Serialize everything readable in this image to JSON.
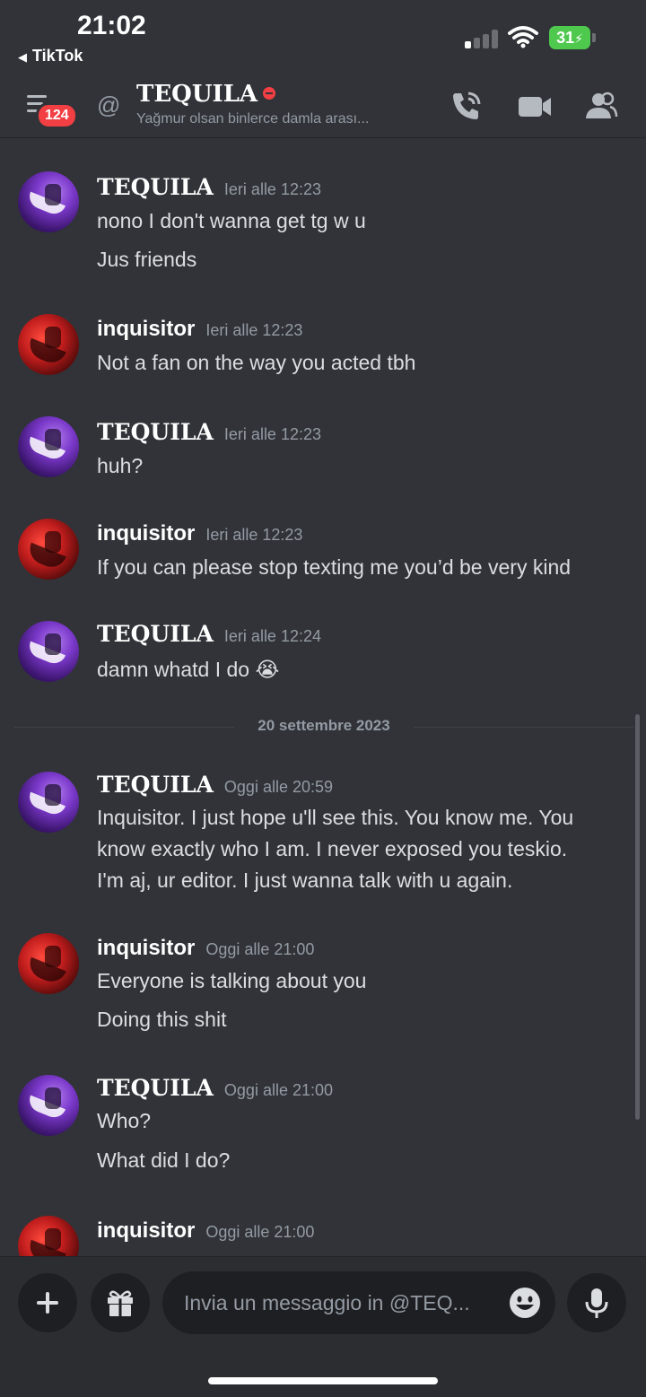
{
  "status_bar": {
    "time": "21:02",
    "back_label": "TikTok",
    "battery": "31"
  },
  "header": {
    "unread_badge": "124",
    "at_symbol": "@",
    "channel_name": "TEQUILA",
    "channel_status": "Yağmur olsan binlerce damla arası...",
    "icons": [
      "hamburger-icon",
      "phone-call-icon",
      "video-icon",
      "members-icon"
    ]
  },
  "messages": [
    {
      "author": "TEQUILA",
      "timestamp": "Ieri alle 12:23",
      "lines": [
        "nono I don't wanna get tg w u",
        "Jus friends"
      ]
    },
    {
      "author": "inquisitor",
      "timestamp": "Ieri alle 12:23",
      "lines": [
        "Not a fan on the way you acted tbh"
      ]
    },
    {
      "author": "TEQUILA",
      "timestamp": "Ieri alle 12:23",
      "lines": [
        "huh?"
      ]
    },
    {
      "author": "inquisitor",
      "timestamp": "Ieri alle 12:23",
      "lines": [
        "If you can please stop texting me you’d be very kind"
      ]
    },
    {
      "author": "TEQUILA",
      "timestamp": "Ieri alle 12:24",
      "lines": [
        "damn whatd I do 😭"
      ]
    },
    {
      "author": "TEQUILA",
      "timestamp": "Oggi alle 20:59",
      "lines": [
        "Inquisitor. I just hope u'll see this. You know me. You",
        "know exactly who I am. I never exposed you teskio.",
        "I'm aj, ur editor. I just wanna talk with u again."
      ]
    },
    {
      "author": "inquisitor",
      "timestamp": "Oggi alle 21:00",
      "lines": [
        "Everyone is talking about you",
        "Doing this shit"
      ]
    },
    {
      "author": "TEQUILA",
      "timestamp": "Oggi alle 21:00",
      "lines": [
        "Who?",
        "What did I do?"
      ]
    },
    {
      "author": "inquisitor",
      "timestamp": "Oggi alle 21:00",
      "lines": []
    }
  ],
  "date_divider": "20 settembre 2023",
  "composer": {
    "placeholder": "Invia un messaggio in @TEQ...",
    "icons": [
      "plus-icon",
      "gift-icon",
      "emoji-icon",
      "microphone-icon"
    ]
  },
  "colors": {
    "background": "#313338",
    "composer_background": "#2b2d31",
    "input_background": "#1e1f22",
    "badge_red": "#f23f43",
    "battery_green": "#4ec94e",
    "muted_text": "#949ba4"
  }
}
